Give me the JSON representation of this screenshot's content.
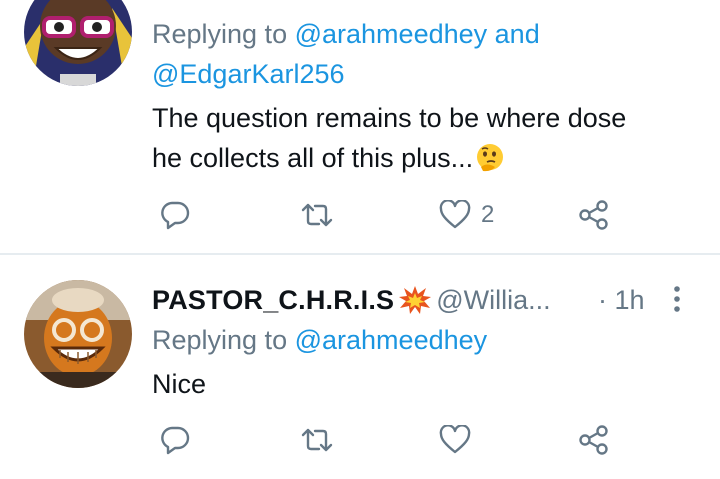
{
  "tweets": [
    {
      "reply_prefix": "Replying to",
      "reply_mentions": [
        "@arahmeedhey",
        "@EdgarKarl256"
      ],
      "reply_joiner": "and",
      "text": "The question remains to be where dose",
      "text_line2": "he collects all of this plus...",
      "emoji": "thinking-face",
      "likes": "2",
      "icons": [
        "reply-icon",
        "retweet-icon",
        "like-icon",
        "share-icon"
      ]
    },
    {
      "display_name": "PASTOR_C.H.R.I.S",
      "name_emoji": "collision-icon",
      "handle": "@Willia...",
      "timestamp": "· 1h",
      "reply_prefix": "Replying to",
      "reply_mentions": [
        "@arahmeedhey"
      ],
      "text": "Nice",
      "icons": [
        "reply-icon",
        "retweet-icon",
        "like-icon",
        "share-icon"
      ]
    }
  ],
  "colors": {
    "text": "#0f1419",
    "secondary": "#657786",
    "link": "#1b95e0",
    "divider": "#e6ecf0"
  }
}
